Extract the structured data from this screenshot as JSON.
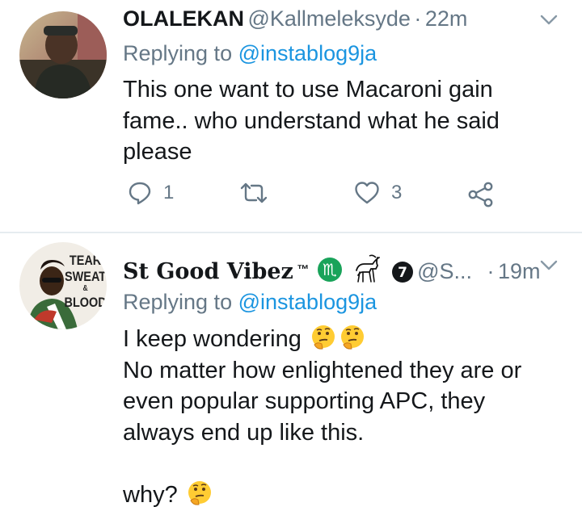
{
  "tweets": [
    {
      "display_name": "OLALEKAN",
      "handle": "@Kallmeleksyde",
      "separator": "·",
      "time": "22m",
      "replying_prefix": "Replying to",
      "replying_to": "@instablog9ja",
      "body_lines": [
        "This one want to use Macaroni gain",
        "fame.. who understand what he said",
        "please"
      ],
      "reply_count": "1",
      "retweet_count": "",
      "like_count": "3"
    },
    {
      "display_name": "St Good Vibez",
      "tm": "™",
      "badge_number": "7",
      "handle": "@S...",
      "separator": "·",
      "time": "19m",
      "replying_prefix": "Replying to",
      "replying_to": "@instablog9ja",
      "avatar_text": [
        "TEAR",
        "SWEAT",
        "&",
        "BLOOD"
      ],
      "body_lines": [
        "I keep wondering",
        "No matter how enlightened they are or",
        "even popular supporting APC, they",
        "always end up like this.",
        "",
        "why?"
      ],
      "emoji": "thinking-face"
    }
  ],
  "colors": {
    "text": "#14171a",
    "secondary": "#657786",
    "link": "#1b95e0",
    "divider": "#e6ecf0",
    "scorpio_badge": "#19a35a"
  }
}
